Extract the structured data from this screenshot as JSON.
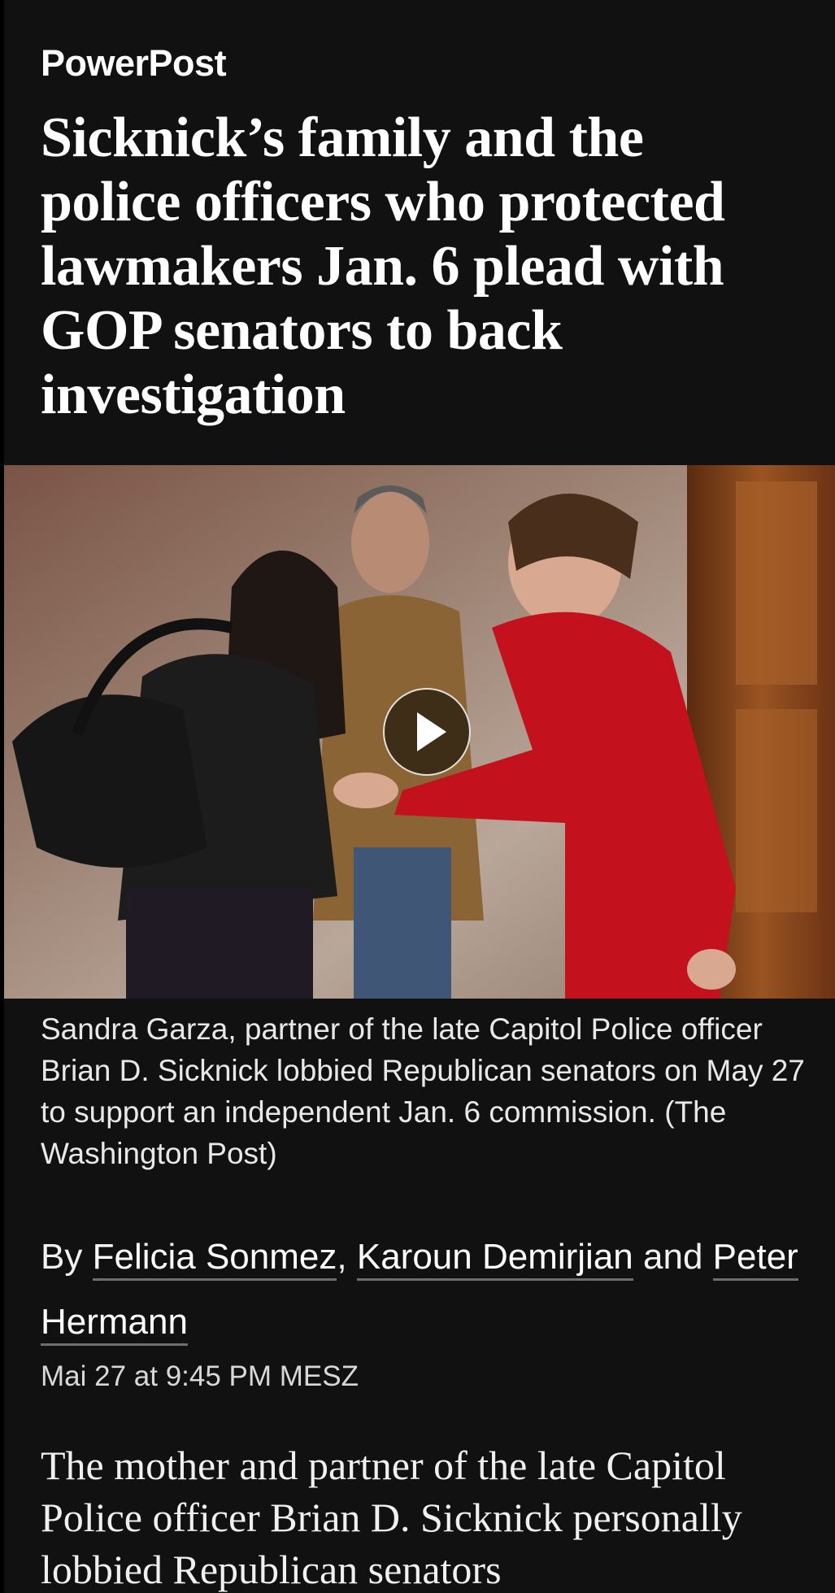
{
  "article": {
    "kicker": "PowerPost",
    "headline": "Sicknick’s family and the police officers who protected lawmakers Jan. 6 plead with GOP senators to back investigation",
    "media": {
      "play_icon": "play-icon"
    },
    "caption": "Sandra Garza, partner of the late Capitol Police officer Brian D. Sicknick lobbied Republican senators on May 27 to support an independent Jan. 6 commission. (The Washington Post)",
    "byline": {
      "prefix": "By",
      "authors": [
        "Felicia Sonmez",
        "Karoun Demirjian",
        "Peter Hermann"
      ],
      "separator": ",",
      "conjunction": "and"
    },
    "timestamp": "Mai 27 at 9:45 PM MESZ",
    "body_first_paragraph": "The mother and partner of the late Capitol Police officer Brian D. Sicknick personally lobbied Republican senators"
  },
  "colors": {
    "background": "#111111",
    "text": "#f2f2f2",
    "link_underline": "#6e6e6e"
  }
}
